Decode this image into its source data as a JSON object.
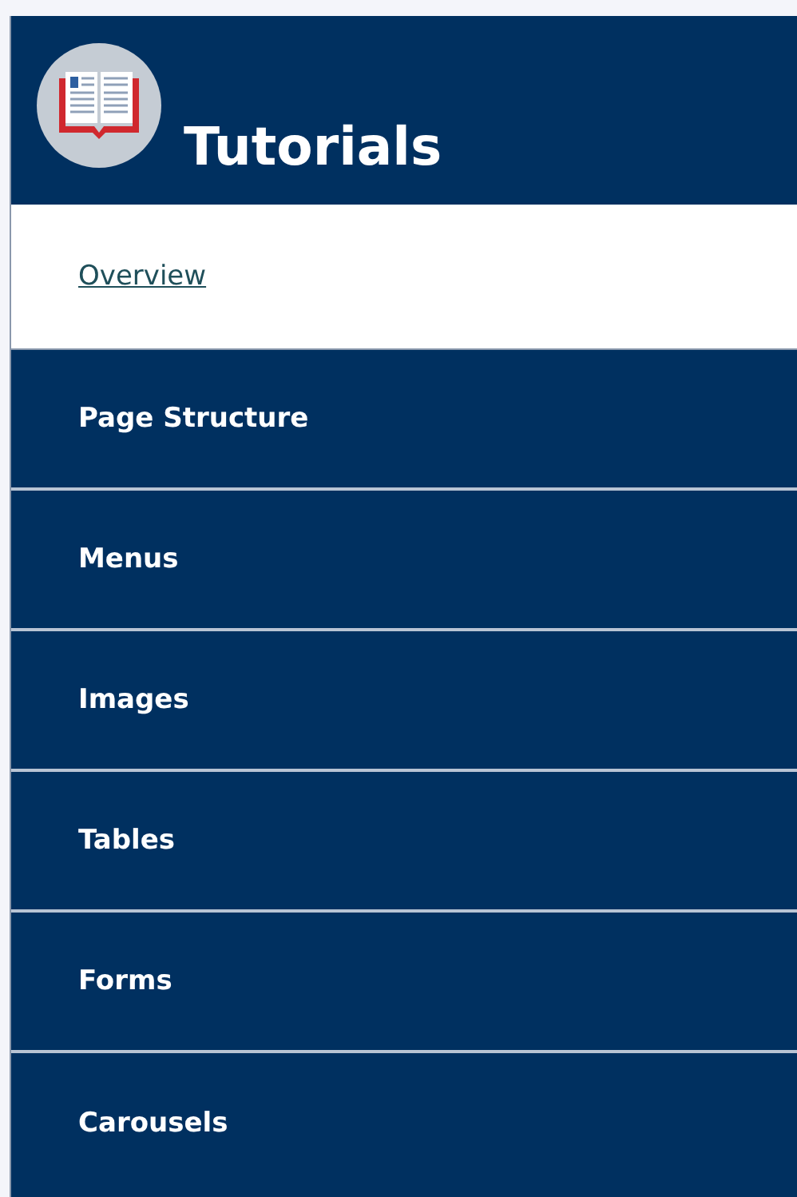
{
  "header": {
    "title": "Tutorials"
  },
  "menu": [
    {
      "label": "Overview",
      "selected": true
    },
    {
      "label": "Page Structure",
      "selected": false
    },
    {
      "label": "Menus",
      "selected": false
    },
    {
      "label": "Images",
      "selected": false
    },
    {
      "label": "Tables",
      "selected": false
    },
    {
      "label": "Forms",
      "selected": false
    },
    {
      "label": "Carousels",
      "selected": false
    }
  ]
}
